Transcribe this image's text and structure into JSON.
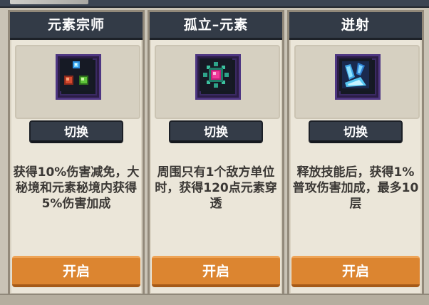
{
  "cards": [
    {
      "title": "元素宗师",
      "icon": "elements-icon",
      "switch_label": "切换",
      "description": "获得10%伤害减免，大秘境和元素秘境内获得5%伤害加成",
      "start_label": "开启"
    },
    {
      "title": "孤立–元素",
      "icon": "isolated-element-icon",
      "switch_label": "切换",
      "description": "周围只有1个敌方单位时，获得120点元素穿透",
      "start_label": "开启"
    },
    {
      "title": "迸射",
      "icon": "burst-icon",
      "switch_label": "切换",
      "description": "释放技能后，获得1%普攻伤害加成，最多10层",
      "start_label": "开启"
    }
  ],
  "colors": {
    "title_bar": "#333b47",
    "card_bg": "#ebe6d9",
    "start_button": "#dc8530",
    "icon_frame": "#4e3682"
  }
}
